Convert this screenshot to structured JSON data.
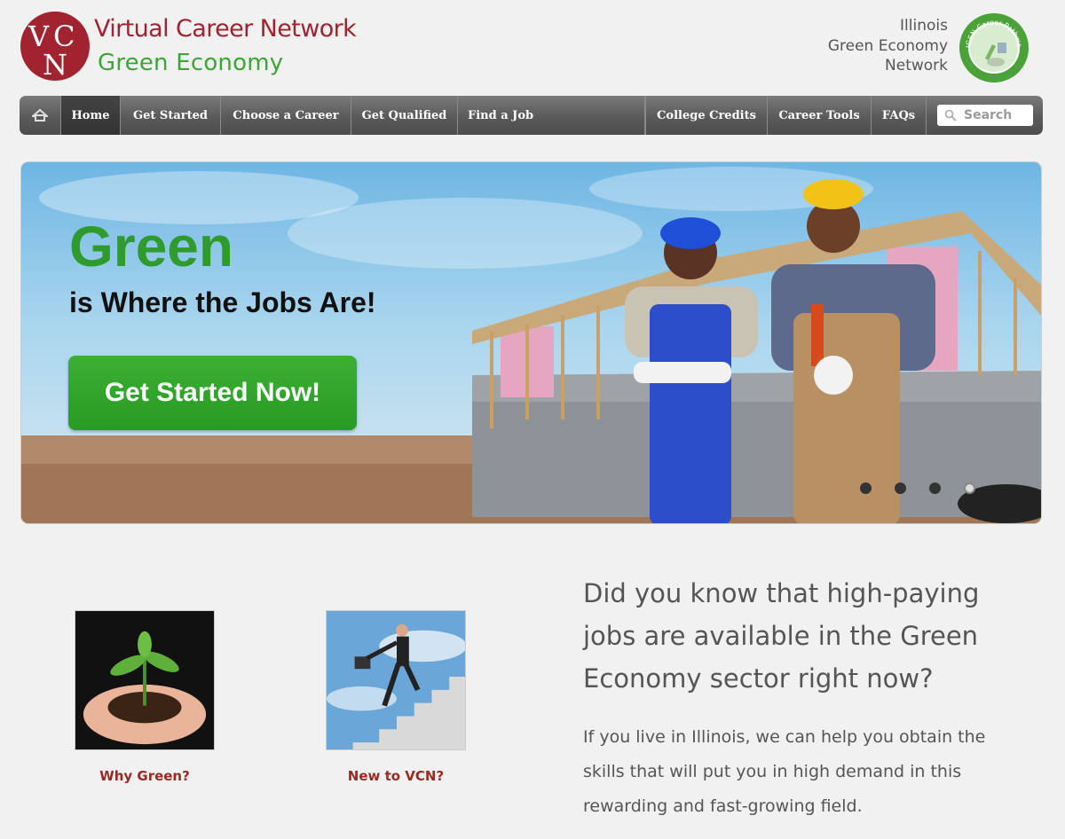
{
  "header": {
    "brand_line1": "Virtual Career Network",
    "brand_line2": "Green Economy",
    "logo_letters": {
      "a": "V",
      "b": "C",
      "c": "N"
    },
    "partner_lines": [
      "Illinois",
      "Green Economy",
      "Network"
    ],
    "seal_text": "IGEN Career Pathways"
  },
  "nav": {
    "items": [
      {
        "label": "Home",
        "active": true
      },
      {
        "label": "Get Started"
      },
      {
        "label": "Choose a Career"
      },
      {
        "label": "Get Qualified"
      },
      {
        "label": "Find a Job"
      },
      {
        "label": "College Credits"
      },
      {
        "label": "Career Tools"
      },
      {
        "label": "FAQs"
      }
    ],
    "search_placeholder": "Search"
  },
  "hero": {
    "title": "Green",
    "subtitle": "is Where the Jobs Are!",
    "cta": "Get Started Now!",
    "slide_count": 4,
    "active_slide": 4
  },
  "tiles": [
    {
      "caption": "Why Green?",
      "icon": "seedling-in-hands"
    },
    {
      "caption": "New to VCN?",
      "icon": "businessman-climbing-stairs"
    }
  ],
  "info": {
    "heading": "Did you know that high-paying jobs are available in the Green Economy sector right now?",
    "body": "If you live in Illinois, we can help you obtain the skills that will put you in high demand in this rewarding and fast-growing field."
  },
  "colors": {
    "brand_red": "#a0232f",
    "brand_green": "#3ea43a",
    "cta_green": "#2e9b2c",
    "caption_red": "#9b2a24",
    "nav_gray": "#5a5a5a"
  }
}
